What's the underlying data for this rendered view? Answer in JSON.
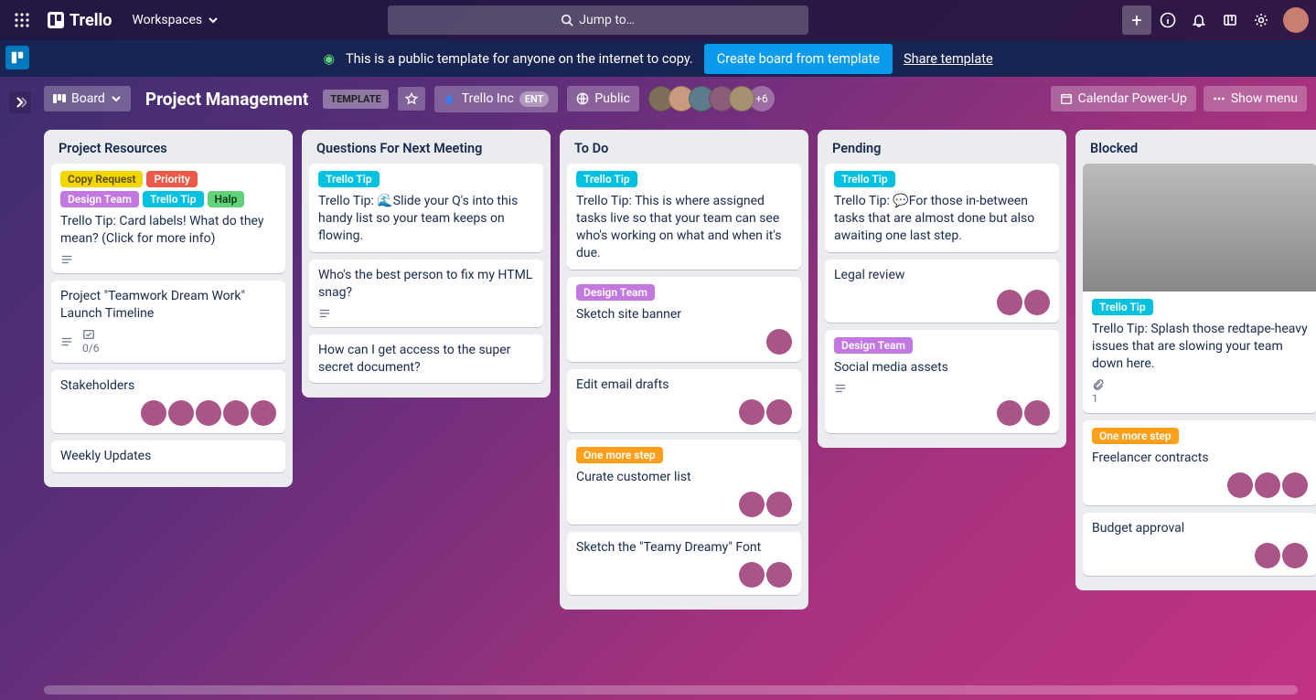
{
  "topbar": {
    "brand": "Trello",
    "workspaces_label": "Workspaces",
    "search_placeholder": "Jump to…"
  },
  "template_bar": {
    "message": "This is a public template for anyone on the internet to copy.",
    "create_label": "Create board from template",
    "share_label": "Share template"
  },
  "board_bar": {
    "view_label": "Board",
    "title": "Project Management",
    "template_badge": "TEMPLATE",
    "company": "Trello Inc",
    "company_badge": "ENT",
    "visibility": "Public",
    "more_members": "+6",
    "calendar_label": "Calendar Power-Up",
    "show_menu_label": "Show menu"
  },
  "labels": {
    "copy_request": "Copy Request",
    "priority": "Priority",
    "design_team": "Design Team",
    "trello_tip": "Trello Tip",
    "halp": "Halp",
    "one_more_step": "One more step"
  },
  "lists": [
    {
      "title": "Project Resources",
      "cards": [
        {
          "labels": [
            "copy_request",
            "priority",
            "design_team",
            "trello_tip",
            "halp"
          ],
          "text": "Trello Tip: Card labels! What do they mean? (Click for more info)",
          "badges": {
            "desc": true
          }
        },
        {
          "text": "Project \"Teamwork Dream Work\" Launch Timeline",
          "badges": {
            "desc": true,
            "check": "0/6"
          }
        },
        {
          "text": "Stakeholders",
          "members": 5
        },
        {
          "text": "Weekly Updates"
        }
      ]
    },
    {
      "title": "Questions For Next Meeting",
      "cards": [
        {
          "labels": [
            "trello_tip"
          ],
          "text": "Trello Tip: 🌊Slide your Q's into this handy list so your team keeps on flowing."
        },
        {
          "text": "Who's the best person to fix my HTML snag?",
          "badges": {
            "desc": true
          }
        },
        {
          "text": "How can I get access to the super secret document?"
        }
      ]
    },
    {
      "title": "To Do",
      "cards": [
        {
          "labels": [
            "trello_tip"
          ],
          "text": "Trello Tip: This is where assigned tasks live so that your team can see who's working on what and when it's due."
        },
        {
          "labels": [
            "design_team"
          ],
          "text": "Sketch site banner",
          "members": 1
        },
        {
          "text": "Edit email drafts",
          "members": 2
        },
        {
          "labels": [
            "one_more_step"
          ],
          "text": "Curate customer list",
          "members": 2
        },
        {
          "text": "Sketch the \"Teamy Dreamy\" Font",
          "members": 2
        }
      ]
    },
    {
      "title": "Pending",
      "cards": [
        {
          "labels": [
            "trello_tip"
          ],
          "text": "Trello Tip: 💬For those in-between tasks that are almost done but also awaiting one last step."
        },
        {
          "text": "Legal review",
          "members": 2
        },
        {
          "labels": [
            "design_team"
          ],
          "text": "Social media assets",
          "badges": {
            "desc": true
          },
          "members": 2
        }
      ]
    },
    {
      "title": "Blocked",
      "cards": [
        {
          "cover": true,
          "labels": [
            "trello_tip"
          ],
          "text": "Trello Tip: Splash those redtape-heavy issues that are slowing your team down here.",
          "badges": {
            "attach": "1"
          }
        },
        {
          "labels": [
            "one_more_step"
          ],
          "text": "Freelancer contracts",
          "members": 3
        },
        {
          "text": "Budget approval",
          "members": 2
        }
      ]
    }
  ]
}
